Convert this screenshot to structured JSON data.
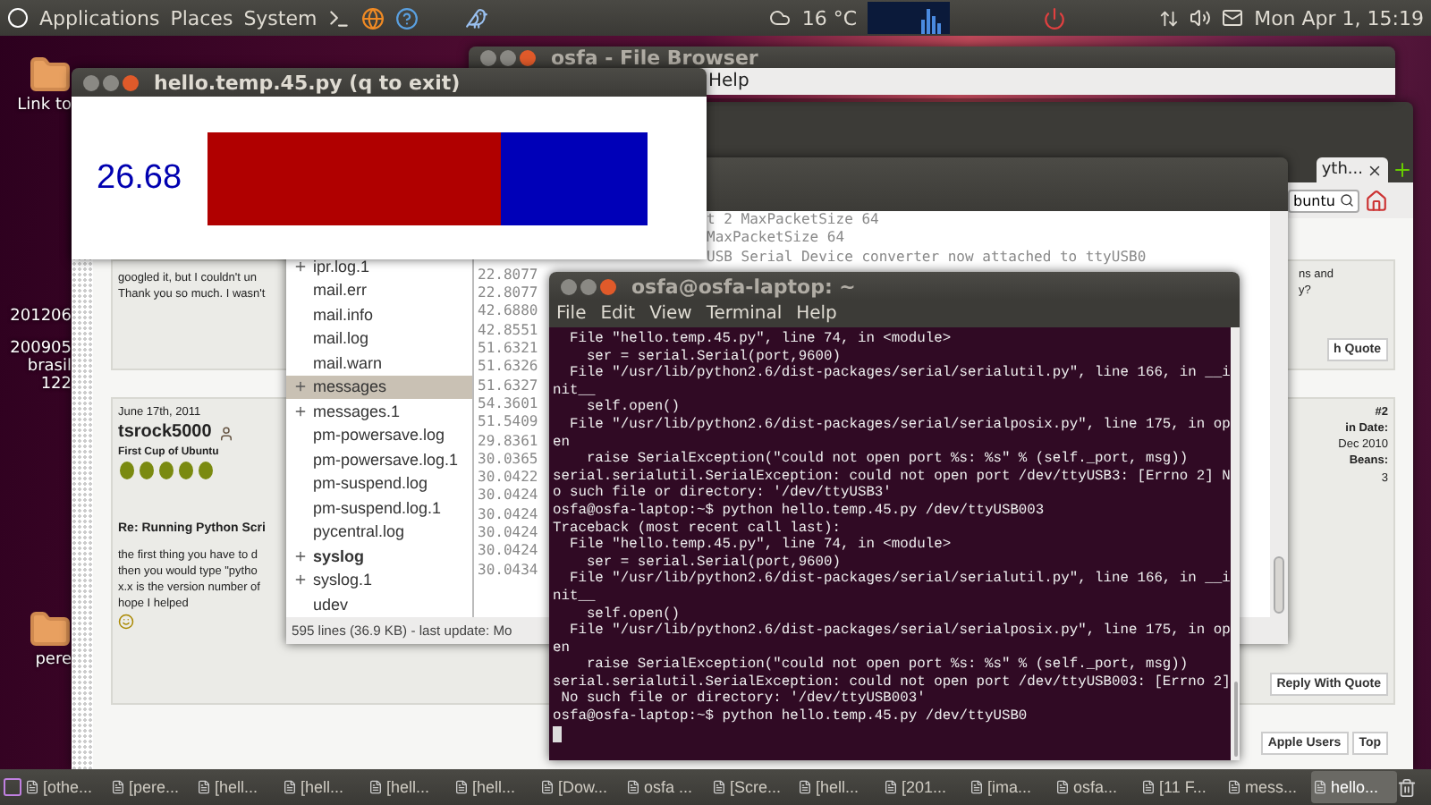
{
  "top_panel": {
    "menus": [
      "Applications",
      "Places",
      "System"
    ],
    "weather": "16 °C",
    "clock": "Mon Apr  1, 15:19"
  },
  "desktop_icons": [
    {
      "lines": [
        "Link to"
      ]
    },
    {
      "lines": [
        "201206"
      ]
    },
    {
      "lines": [
        "200905",
        "brasil",
        "122"
      ]
    },
    {
      "lines": [
        "pere"
      ]
    }
  ],
  "browser": {
    "tab": {
      "label": "yth...",
      "selected": true
    },
    "search": {
      "value": "buntu"
    },
    "posts": [
      {
        "text_lines": [
          "googled it, but I couldn't un",
          "Thank you so much. I wasn't"
        ],
        "side_lines": [
          "ns and",
          "y?"
        ],
        "action": "h Quote"
      },
      {
        "date": "June 17th, 2011",
        "author": "tsrock5000",
        "rank": "First Cup of Ubuntu",
        "title": "Re: Running Python Scri",
        "text_lines": [
          "the first thing you have to d",
          "then you would type \"pytho",
          "x.x is the version number of",
          "hope I helped"
        ],
        "number": "#2",
        "side_lines": [
          "in Date:",
          "Dec 2010",
          "Beans:",
          "3"
        ],
        "action": "Reply With Quote"
      }
    ],
    "footer_buttons": [
      "Apple Users",
      "Top"
    ]
  },
  "file_browser": {
    "title": "osfa - File Browser",
    "menu": [
      "Help"
    ]
  },
  "log_viewer": {
    "files": [
      {
        "name": "ipr.log.1",
        "expandable": true,
        "bold": false,
        "selected": false
      },
      {
        "name": "mail.err",
        "expandable": false,
        "bold": false,
        "selected": false
      },
      {
        "name": "mail.info",
        "expandable": false,
        "bold": false,
        "selected": false
      },
      {
        "name": "mail.log",
        "expandable": false,
        "bold": false,
        "selected": false
      },
      {
        "name": "mail.warn",
        "expandable": false,
        "bold": false,
        "selected": false
      },
      {
        "name": "messages",
        "expandable": true,
        "bold": false,
        "selected": true
      },
      {
        "name": "messages.1",
        "expandable": true,
        "bold": false,
        "selected": false
      },
      {
        "name": "pm-powersave.log",
        "expandable": false,
        "bold": false,
        "selected": false
      },
      {
        "name": "pm-powersave.log.1",
        "expandable": false,
        "bold": false,
        "selected": false
      },
      {
        "name": "pm-suspend.log",
        "expandable": false,
        "bold": false,
        "selected": false
      },
      {
        "name": "pm-suspend.log.1",
        "expandable": false,
        "bold": false,
        "selected": false
      },
      {
        "name": "pycentral.log",
        "expandable": false,
        "bold": false,
        "selected": false
      },
      {
        "name": "syslog",
        "expandable": true,
        "bold": true,
        "selected": false
      },
      {
        "name": "syslog.1",
        "expandable": true,
        "bold": false,
        "selected": false
      },
      {
        "name": "udev",
        "expandable": false,
        "bold": false,
        "selected": false
      }
    ],
    "tail_lines": [
      "t 2 MaxPacketSize 64",
      "MaxPacketSize 64",
      "USB Serial Device converter now attached to ttyUSB0"
    ],
    "timestamps": [
      "22.8077",
      "22.8077",
      "42.6880",
      "42.8551",
      "51.6321",
      "51.6326",
      "51.6327",
      "54.3601",
      "51.5409",
      "29.8361",
      "30.0365",
      "30.0422",
      "30.0424",
      "30.0424",
      "30.0424",
      "30.0424",
      "30.0434"
    ],
    "status": "595 lines (36.9 KB) - last update: Mo"
  },
  "hello_window": {
    "title": "hello.temp.45.py (q to exit)",
    "reading": "26.68",
    "level": 0.67
  },
  "terminal": {
    "title": "osfa@osfa-laptop: ~",
    "menu": [
      "File",
      "Edit",
      "View",
      "Terminal",
      "Help"
    ],
    "lines": [
      "  File \"hello.temp.45.py\", line 74, in <module>",
      "    ser = serial.Serial(port,9600)",
      "  File \"/usr/lib/python2.6/dist-packages/serial/serialutil.py\", line 166, in __i",
      "nit__",
      "    self.open()",
      "  File \"/usr/lib/python2.6/dist-packages/serial/serialposix.py\", line 175, in op",
      "en",
      "    raise SerialException(\"could not open port %s: %s\" % (self._port, msg))",
      "serial.serialutil.SerialException: could not open port /dev/ttyUSB3: [Errno 2] N",
      "o such file or directory: '/dev/ttyUSB3'",
      "osfa@osfa-laptop:~$ python hello.temp.45.py /dev/ttyUSB003",
      "Traceback (most recent call last):",
      "  File \"hello.temp.45.py\", line 74, in <module>",
      "    ser = serial.Serial(port,9600)",
      "  File \"/usr/lib/python2.6/dist-packages/serial/serialutil.py\", line 166, in __i",
      "nit__",
      "    self.open()",
      "  File \"/usr/lib/python2.6/dist-packages/serial/serialposix.py\", line 175, in op",
      "en",
      "    raise SerialException(\"could not open port %s: %s\" % (self._port, msg))",
      "serial.serialutil.SerialException: could not open port /dev/ttyUSB003: [Errno 2]",
      " No such file or directory: '/dev/ttyUSB003'",
      "osfa@osfa-laptop:~$ python hello.temp.45.py /dev/ttyUSB0"
    ]
  },
  "taskbar": [
    {
      "label": "[othe...",
      "selected": false
    },
    {
      "label": "[pere...",
      "selected": false
    },
    {
      "label": "[hell...",
      "selected": false
    },
    {
      "label": "[hell...",
      "selected": false
    },
    {
      "label": "[hell...",
      "selected": false
    },
    {
      "label": "[hell...",
      "selected": false
    },
    {
      "label": "[Dow...",
      "selected": false
    },
    {
      "label": "osfa ...",
      "selected": false
    },
    {
      "label": "[Scre...",
      "selected": false
    },
    {
      "label": "[hell...",
      "selected": false
    },
    {
      "label": "[201...",
      "selected": false
    },
    {
      "label": "[ima...",
      "selected": false
    },
    {
      "label": "osfa...",
      "selected": false
    },
    {
      "label": "[11 F...",
      "selected": false
    },
    {
      "label": "mess...",
      "selected": false
    },
    {
      "label": "hello...",
      "selected": true
    }
  ]
}
